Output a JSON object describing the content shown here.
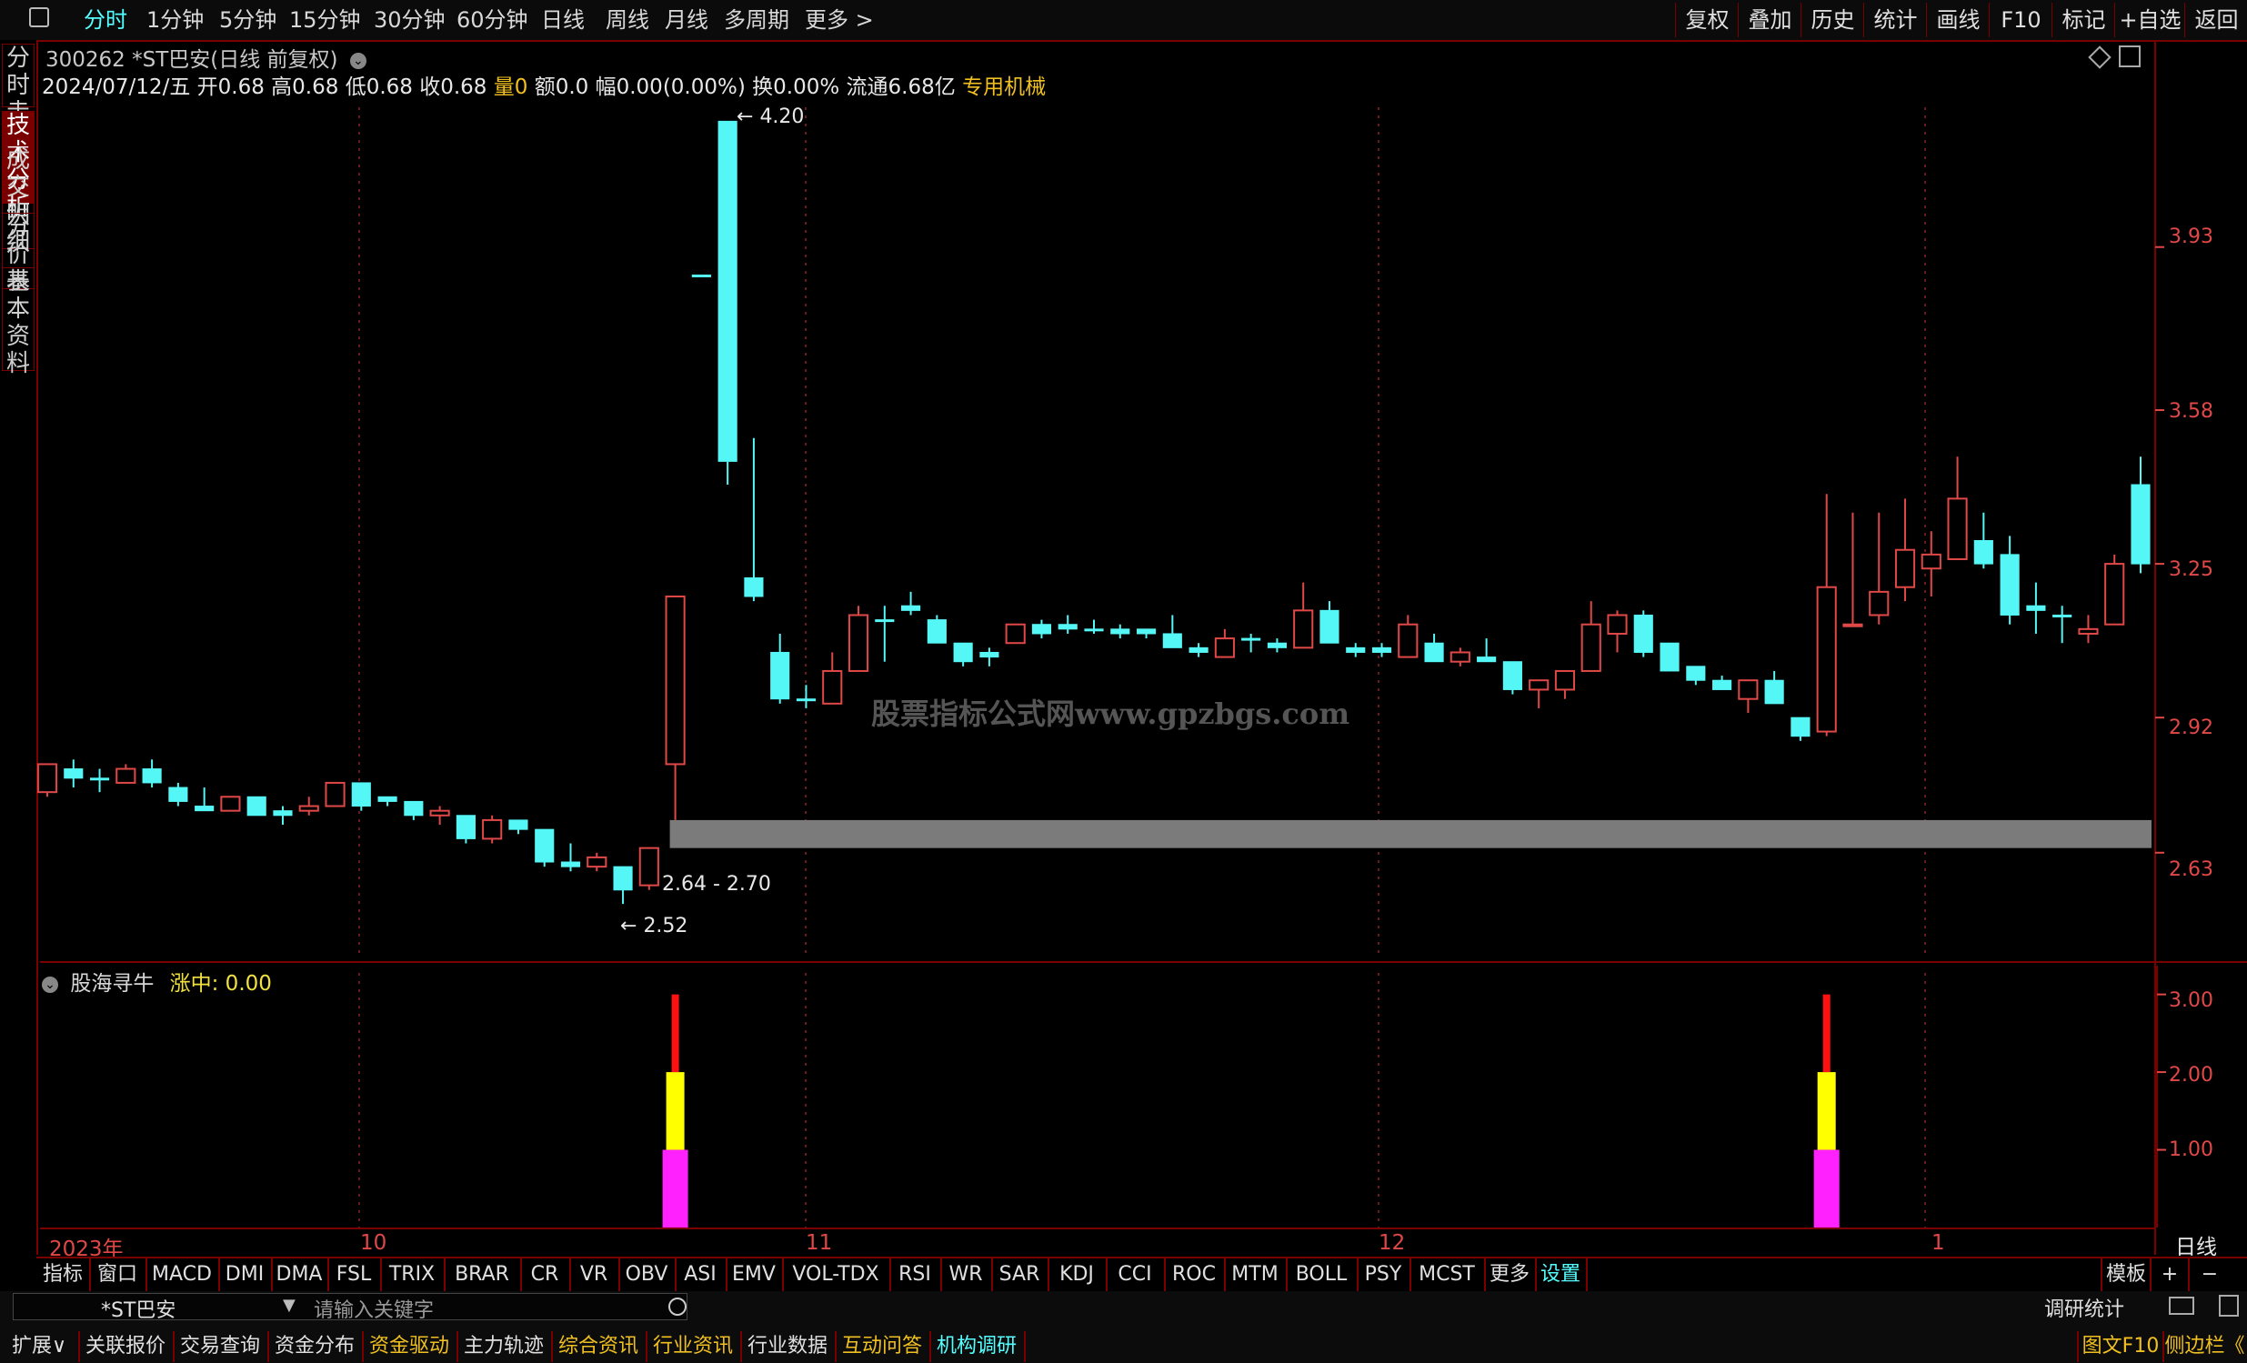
{
  "toolbar": {
    "tabs": [
      "分时",
      "1分钟",
      "5分钟",
      "15分钟",
      "30分钟",
      "60分钟",
      "日线",
      "周线",
      "月线",
      "多周期",
      "更多 >"
    ],
    "right_buttons": [
      "复权",
      "叠加",
      "历史",
      "统计",
      "画线",
      "F10",
      "标记",
      "+自选",
      "返回"
    ]
  },
  "left_tabs": [
    "分时走势",
    "技术分析",
    "成交明细",
    "分价表",
    "基本资料"
  ],
  "stock": {
    "title": "300262 *ST巴安(日线 前复权)",
    "info_date": "2024/07/12/五",
    "info_open": "开0.68",
    "info_high": "高0.68",
    "info_low": "低0.68",
    "info_close": "收0.68",
    "info_vol": "量0",
    "info_amount": "额0.0",
    "info_amp": "幅0.00(0.00%)",
    "info_turnover": "换0.00%",
    "info_float": "流通6.68亿",
    "info_sector": "专用机械"
  },
  "watermark": "股票指标公式网www.gpzbgs.com",
  "price_axis": [
    "3.93",
    "3.58",
    "3.25",
    "2.92",
    "2.63"
  ],
  "annotations": {
    "high": "4.20",
    "low": "2.52",
    "gap": "2.64 - 2.70"
  },
  "indicator": {
    "name": "股海寻牛",
    "value_label": "涨中: 0.00",
    "axis": [
      "3.00",
      "2.00",
      "1.00"
    ]
  },
  "date_axis": {
    "labels": [
      "2023年",
      "10",
      "11",
      "12",
      "1"
    ],
    "period": "日线"
  },
  "indicator_tabs": [
    "指标",
    "窗口",
    "MACD",
    "DMI",
    "DMA",
    "FSL",
    "TRIX",
    "BRAR",
    "CR",
    "VR",
    "OBV",
    "ASI",
    "EMV",
    "VOL-TDX",
    "RSI",
    "WR",
    "SAR",
    "KDJ",
    "CCI",
    "ROC",
    "MTM",
    "BOLL",
    "PSY",
    "MCST",
    "更多",
    "设置"
  ],
  "template_label": "模板",
  "bottom": {
    "search_stock": "*ST巴安",
    "search_placeholder": "请输入关键字",
    "research_label": "调研统计",
    "tabs": [
      "扩展∨",
      "关联报价",
      "交易查询",
      "资金分布",
      "资金驱动",
      "主力轨迹",
      "综合资讯",
      "行业资讯",
      "行业数据",
      "互动问答",
      "机构调研"
    ],
    "right_tabs": [
      "图文F10",
      "侧边栏《"
    ]
  },
  "colors": {
    "up": "#e04848",
    "down": "#55f6f6",
    "border": "#7a0000",
    "accent": "#5ff",
    "gold": "#f0c020"
  },
  "chart_data": {
    "type": "candlestick",
    "series": [
      {
        "o": 2.76,
        "h": 2.82,
        "l": 2.75,
        "c": 2.82,
        "up": true
      },
      {
        "o": 2.81,
        "h": 2.83,
        "l": 2.77,
        "c": 2.79,
        "up": false
      },
      {
        "o": 2.79,
        "h": 2.81,
        "l": 2.76,
        "c": 2.79,
        "up": false
      },
      {
        "o": 2.78,
        "h": 2.82,
        "l": 2.78,
        "c": 2.81,
        "up": true
      },
      {
        "o": 2.81,
        "h": 2.83,
        "l": 2.77,
        "c": 2.78,
        "up": false
      },
      {
        "o": 2.77,
        "h": 2.78,
        "l": 2.73,
        "c": 2.74,
        "up": false
      },
      {
        "o": 2.73,
        "h": 2.77,
        "l": 2.72,
        "c": 2.72,
        "up": false
      },
      {
        "o": 2.72,
        "h": 2.75,
        "l": 2.72,
        "c": 2.75,
        "up": true
      },
      {
        "o": 2.75,
        "h": 2.75,
        "l": 2.71,
        "c": 2.71,
        "up": false
      },
      {
        "o": 2.72,
        "h": 2.73,
        "l": 2.69,
        "c": 2.71,
        "up": false
      },
      {
        "o": 2.72,
        "h": 2.75,
        "l": 2.71,
        "c": 2.73,
        "up": true
      },
      {
        "o": 2.73,
        "h": 2.78,
        "l": 2.73,
        "c": 2.78,
        "up": true
      },
      {
        "o": 2.78,
        "h": 2.78,
        "l": 2.72,
        "c": 2.73,
        "up": false
      },
      {
        "o": 2.75,
        "h": 2.75,
        "l": 2.73,
        "c": 2.74,
        "up": false
      },
      {
        "o": 2.74,
        "h": 2.74,
        "l": 2.7,
        "c": 2.71,
        "up": false
      },
      {
        "o": 2.71,
        "h": 2.73,
        "l": 2.69,
        "c": 2.72,
        "up": true
      },
      {
        "o": 2.71,
        "h": 2.71,
        "l": 2.65,
        "c": 2.66,
        "up": false
      },
      {
        "o": 2.66,
        "h": 2.71,
        "l": 2.65,
        "c": 2.7,
        "up": true
      },
      {
        "o": 2.7,
        "h": 2.7,
        "l": 2.67,
        "c": 2.68,
        "up": false
      },
      {
        "o": 2.68,
        "h": 2.68,
        "l": 2.6,
        "c": 2.61,
        "up": false
      },
      {
        "o": 2.61,
        "h": 2.65,
        "l": 2.59,
        "c": 2.6,
        "up": false
      },
      {
        "o": 2.6,
        "h": 2.63,
        "l": 2.59,
        "c": 2.62,
        "up": true
      },
      {
        "o": 2.6,
        "h": 2.6,
        "l": 2.52,
        "c": 2.55,
        "up": false
      },
      {
        "o": 2.56,
        "h": 2.64,
        "l": 2.55,
        "c": 2.64,
        "up": true
      },
      {
        "o": 2.82,
        "h": 3.18,
        "l": 2.7,
        "c": 3.18,
        "up": true
      },
      {
        "o": 3.87,
        "h": 3.87,
        "l": 3.87,
        "c": 3.87,
        "up": false
      },
      {
        "o": 4.2,
        "h": 4.2,
        "l": 3.42,
        "c": 3.47,
        "up": false
      },
      {
        "o": 3.22,
        "h": 3.52,
        "l": 3.17,
        "c": 3.18,
        "up": false
      },
      {
        "o": 3.06,
        "h": 3.1,
        "l": 2.95,
        "c": 2.96,
        "up": false
      },
      {
        "o": 2.96,
        "h": 2.99,
        "l": 2.94,
        "c": 2.96,
        "up": false
      },
      {
        "o": 2.95,
        "h": 3.06,
        "l": 2.95,
        "c": 3.02,
        "up": true
      },
      {
        "o": 3.02,
        "h": 3.16,
        "l": 3.02,
        "c": 3.14,
        "up": true
      },
      {
        "o": 3.13,
        "h": 3.16,
        "l": 3.04,
        "c": 3.13,
        "up": false
      },
      {
        "o": 3.16,
        "h": 3.19,
        "l": 3.14,
        "c": 3.15,
        "up": false
      },
      {
        "o": 3.13,
        "h": 3.14,
        "l": 3.08,
        "c": 3.08,
        "up": false
      },
      {
        "o": 3.08,
        "h": 3.08,
        "l": 3.03,
        "c": 3.04,
        "up": false
      },
      {
        "o": 3.06,
        "h": 3.07,
        "l": 3.03,
        "c": 3.05,
        "up": false
      },
      {
        "o": 3.08,
        "h": 3.12,
        "l": 3.08,
        "c": 3.12,
        "up": true
      },
      {
        "o": 3.12,
        "h": 3.13,
        "l": 3.09,
        "c": 3.1,
        "up": false
      },
      {
        "o": 3.12,
        "h": 3.14,
        "l": 3.1,
        "c": 3.11,
        "up": false
      },
      {
        "o": 3.11,
        "h": 3.13,
        "l": 3.1,
        "c": 3.11,
        "up": false
      },
      {
        "o": 3.11,
        "h": 3.12,
        "l": 3.09,
        "c": 3.1,
        "up": false
      },
      {
        "o": 3.11,
        "h": 3.11,
        "l": 3.09,
        "c": 3.1,
        "up": false
      },
      {
        "o": 3.1,
        "h": 3.14,
        "l": 3.07,
        "c": 3.07,
        "up": false
      },
      {
        "o": 3.07,
        "h": 3.08,
        "l": 3.05,
        "c": 3.06,
        "up": false
      },
      {
        "o": 3.05,
        "h": 3.11,
        "l": 3.05,
        "c": 3.09,
        "up": true
      },
      {
        "o": 3.09,
        "h": 3.1,
        "l": 3.06,
        "c": 3.09,
        "up": false
      },
      {
        "o": 3.08,
        "h": 3.09,
        "l": 3.06,
        "c": 3.07,
        "up": false
      },
      {
        "o": 3.07,
        "h": 3.21,
        "l": 3.07,
        "c": 3.15,
        "up": true
      },
      {
        "o": 3.15,
        "h": 3.17,
        "l": 3.08,
        "c": 3.08,
        "up": false
      },
      {
        "o": 3.07,
        "h": 3.08,
        "l": 3.05,
        "c": 3.06,
        "up": false
      },
      {
        "o": 3.07,
        "h": 3.08,
        "l": 3.05,
        "c": 3.06,
        "up": false
      },
      {
        "o": 3.05,
        "h": 3.14,
        "l": 3.05,
        "c": 3.12,
        "up": true
      },
      {
        "o": 3.08,
        "h": 3.1,
        "l": 3.04,
        "c": 3.04,
        "up": false
      },
      {
        "o": 3.04,
        "h": 3.07,
        "l": 3.03,
        "c": 3.06,
        "up": true
      },
      {
        "o": 3.05,
        "h": 3.09,
        "l": 3.04,
        "c": 3.04,
        "up": false
      },
      {
        "o": 3.04,
        "h": 3.04,
        "l": 2.97,
        "c": 2.98,
        "up": false
      },
      {
        "o": 2.98,
        "h": 3.0,
        "l": 2.94,
        "c": 3.0,
        "up": true
      },
      {
        "o": 2.98,
        "h": 3.02,
        "l": 2.96,
        "c": 3.02,
        "up": true
      },
      {
        "o": 3.02,
        "h": 3.17,
        "l": 3.02,
        "c": 3.12,
        "up": true
      },
      {
        "o": 3.1,
        "h": 3.15,
        "l": 3.06,
        "c": 3.14,
        "up": true
      },
      {
        "o": 3.14,
        "h": 3.15,
        "l": 3.05,
        "c": 3.06,
        "up": false
      },
      {
        "o": 3.08,
        "h": 3.08,
        "l": 3.02,
        "c": 3.02,
        "up": false
      },
      {
        "o": 3.03,
        "h": 3.03,
        "l": 2.99,
        "c": 3.0,
        "up": false
      },
      {
        "o": 3.0,
        "h": 3.01,
        "l": 2.98,
        "c": 2.98,
        "up": false
      },
      {
        "o": 2.96,
        "h": 3.0,
        "l": 2.93,
        "c": 3.0,
        "up": true
      },
      {
        "o": 3.0,
        "h": 3.02,
        "l": 2.95,
        "c": 2.95,
        "up": false
      },
      {
        "o": 2.92,
        "h": 2.92,
        "l": 2.87,
        "c": 2.88,
        "up": false
      },
      {
        "o": 2.89,
        "h": 3.4,
        "l": 2.88,
        "c": 3.2,
        "up": true
      },
      {
        "o": 3.12,
        "h": 3.36,
        "l": 3.12,
        "c": 3.12,
        "up": true
      },
      {
        "o": 3.14,
        "h": 3.36,
        "l": 3.12,
        "c": 3.19,
        "up": true
      },
      {
        "o": 3.2,
        "h": 3.39,
        "l": 3.17,
        "c": 3.28,
        "up": true
      },
      {
        "o": 3.24,
        "h": 3.32,
        "l": 3.18,
        "c": 3.27,
        "up": true
      },
      {
        "o": 3.26,
        "h": 3.48,
        "l": 3.26,
        "c": 3.39,
        "up": true
      },
      {
        "o": 3.3,
        "h": 3.36,
        "l": 3.24,
        "c": 3.25,
        "up": false
      },
      {
        "o": 3.27,
        "h": 3.31,
        "l": 3.12,
        "c": 3.14,
        "up": false
      },
      {
        "o": 3.16,
        "h": 3.21,
        "l": 3.1,
        "c": 3.15,
        "up": false
      },
      {
        "o": 3.14,
        "h": 3.16,
        "l": 3.08,
        "c": 3.14,
        "up": false
      },
      {
        "o": 3.1,
        "h": 3.14,
        "l": 3.08,
        "c": 3.11,
        "up": true
      },
      {
        "o": 3.12,
        "h": 3.27,
        "l": 3.12,
        "c": 3.25,
        "up": true
      },
      {
        "o": 3.42,
        "h": 3.48,
        "l": 3.23,
        "c": 3.25,
        "up": false
      }
    ],
    "gap_zone": [
      2.64,
      2.7
    ],
    "signals": [
      {
        "bar": 24,
        "value": 3
      },
      {
        "bar": 68,
        "value": 3
      }
    ],
    "ylim": [
      2.45,
      4.23
    ],
    "indicator_ylim": [
      0,
      3.3
    ]
  }
}
